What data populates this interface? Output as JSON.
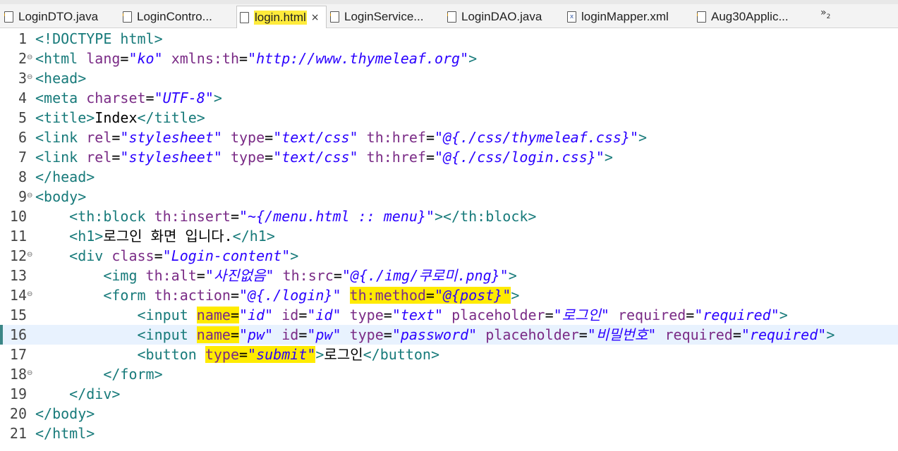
{
  "tabs": [
    {
      "label": "LoginDTO.java",
      "icon": "java-file-icon"
    },
    {
      "label": "LoginContro...",
      "icon": "java-file-icon"
    },
    {
      "label": "login.html",
      "icon": "html-file-icon",
      "active": true
    },
    {
      "label": "LoginService...",
      "icon": "java-file-icon"
    },
    {
      "label": "LoginDAO.java",
      "icon": "java-file-icon"
    },
    {
      "label": "loginMapper.xml",
      "icon": "xml-file-icon"
    },
    {
      "label": "Aug30Applic...",
      "icon": "java-file-icon"
    }
  ],
  "close_glyph": "×",
  "overflow": {
    "glyph": "»",
    "count": "2"
  },
  "colors": {
    "tag": "#177a7a",
    "attribute": "#7a2b86",
    "value": "#2a00ff",
    "highlight": "#ffeb00",
    "current_line": "#e8f2fe"
  },
  "lines": [
    {
      "n": "1",
      "fold": false,
      "parts": [
        {
          "c": "t",
          "s": "<!DOCTYPE html>"
        }
      ]
    },
    {
      "n": "2",
      "fold": true,
      "parts": [
        {
          "c": "t",
          "s": "<html "
        },
        {
          "c": "a",
          "s": "lang"
        },
        {
          "c": "x",
          "s": "="
        },
        {
          "c": "v",
          "s": "\"ko\""
        },
        {
          "c": "x",
          "s": " "
        },
        {
          "c": "a",
          "s": "xmlns:th"
        },
        {
          "c": "x",
          "s": "="
        },
        {
          "c": "v",
          "s": "\"http://www.thymeleaf.org\""
        },
        {
          "c": "t",
          "s": ">"
        }
      ]
    },
    {
      "n": "3",
      "fold": true,
      "parts": [
        {
          "c": "t",
          "s": "<head>"
        }
      ]
    },
    {
      "n": "4",
      "fold": false,
      "parts": [
        {
          "c": "t",
          "s": "<meta "
        },
        {
          "c": "a",
          "s": "charset"
        },
        {
          "c": "x",
          "s": "="
        },
        {
          "c": "v",
          "s": "\"UTF-8\""
        },
        {
          "c": "t",
          "s": ">"
        }
      ]
    },
    {
      "n": "5",
      "fold": false,
      "parts": [
        {
          "c": "t",
          "s": "<title>"
        },
        {
          "c": "x",
          "s": "Index"
        },
        {
          "c": "t",
          "s": "</title>"
        }
      ]
    },
    {
      "n": "6",
      "fold": false,
      "parts": [
        {
          "c": "t",
          "s": "<link "
        },
        {
          "c": "a",
          "s": "rel"
        },
        {
          "c": "x",
          "s": "="
        },
        {
          "c": "v",
          "s": "\"stylesheet\""
        },
        {
          "c": "x",
          "s": " "
        },
        {
          "c": "a",
          "s": "type"
        },
        {
          "c": "x",
          "s": "="
        },
        {
          "c": "v",
          "s": "\"text/css\""
        },
        {
          "c": "x",
          "s": " "
        },
        {
          "c": "a",
          "s": "th:href"
        },
        {
          "c": "x",
          "s": "="
        },
        {
          "c": "v",
          "s": "\"@{./css/thymeleaf.css}\""
        },
        {
          "c": "t",
          "s": ">"
        }
      ]
    },
    {
      "n": "7",
      "fold": false,
      "parts": [
        {
          "c": "t",
          "s": "<link "
        },
        {
          "c": "a",
          "s": "rel"
        },
        {
          "c": "x",
          "s": "="
        },
        {
          "c": "v",
          "s": "\"stylesheet\""
        },
        {
          "c": "x",
          "s": " "
        },
        {
          "c": "a",
          "s": "type"
        },
        {
          "c": "x",
          "s": "="
        },
        {
          "c": "v",
          "s": "\"text/css\""
        },
        {
          "c": "x",
          "s": " "
        },
        {
          "c": "a",
          "s": "th:href"
        },
        {
          "c": "x",
          "s": "="
        },
        {
          "c": "v",
          "s": "\"@{./css/login.css}\""
        },
        {
          "c": "t",
          "s": ">"
        }
      ]
    },
    {
      "n": "8",
      "fold": false,
      "parts": [
        {
          "c": "t",
          "s": "</head>"
        }
      ]
    },
    {
      "n": "9",
      "fold": true,
      "parts": [
        {
          "c": "t",
          "s": "<body>"
        }
      ]
    },
    {
      "n": "10",
      "fold": false,
      "parts": [
        {
          "c": "x",
          "s": "    "
        },
        {
          "c": "t",
          "s": "<th:block "
        },
        {
          "c": "a",
          "s": "th:insert"
        },
        {
          "c": "x",
          "s": "="
        },
        {
          "c": "v",
          "s": "\"~{/menu.html :: menu}\""
        },
        {
          "c": "t",
          "s": "></th:block>"
        }
      ]
    },
    {
      "n": "11",
      "fold": false,
      "parts": [
        {
          "c": "x",
          "s": "    "
        },
        {
          "c": "t",
          "s": "<h1>"
        },
        {
          "c": "x",
          "s": "로그인 화면 입니다."
        },
        {
          "c": "t",
          "s": "</h1>"
        }
      ]
    },
    {
      "n": "12",
      "fold": true,
      "parts": [
        {
          "c": "x",
          "s": "    "
        },
        {
          "c": "t",
          "s": "<div "
        },
        {
          "c": "a",
          "s": "class"
        },
        {
          "c": "x",
          "s": "="
        },
        {
          "c": "v",
          "s": "\"Login-content\""
        },
        {
          "c": "t",
          "s": ">"
        }
      ]
    },
    {
      "n": "13",
      "fold": false,
      "parts": [
        {
          "c": "x",
          "s": "        "
        },
        {
          "c": "t",
          "s": "<img "
        },
        {
          "c": "a",
          "s": "th:alt"
        },
        {
          "c": "x",
          "s": "="
        },
        {
          "c": "v",
          "s": "\"사진없음\""
        },
        {
          "c": "x",
          "s": " "
        },
        {
          "c": "a",
          "s": "th:src"
        },
        {
          "c": "x",
          "s": "="
        },
        {
          "c": "v",
          "s": "\"@{./img/쿠로미.png}\""
        },
        {
          "c": "t",
          "s": ">"
        }
      ]
    },
    {
      "n": "14",
      "fold": true,
      "parts": [
        {
          "c": "x",
          "s": "        "
        },
        {
          "c": "t",
          "s": "<form "
        },
        {
          "c": "a",
          "s": "th:action"
        },
        {
          "c": "x",
          "s": "="
        },
        {
          "c": "v",
          "s": "\"@{./login}\""
        },
        {
          "c": "x",
          "s": " "
        },
        {
          "c": "a",
          "s": "th:method",
          "h": true
        },
        {
          "c": "x",
          "s": "=",
          "h": true
        },
        {
          "c": "v",
          "s": "\"@{post}\"",
          "h": true
        },
        {
          "c": "t",
          "s": ">"
        }
      ]
    },
    {
      "n": "15",
      "fold": false,
      "parts": [
        {
          "c": "x",
          "s": "            "
        },
        {
          "c": "t",
          "s": "<input "
        },
        {
          "c": "a",
          "s": "name",
          "h": true
        },
        {
          "c": "x",
          "s": "=",
          "h": true
        },
        {
          "c": "v",
          "s": "\"id\""
        },
        {
          "c": "x",
          "s": " "
        },
        {
          "c": "a",
          "s": "id"
        },
        {
          "c": "x",
          "s": "="
        },
        {
          "c": "v",
          "s": "\"id\""
        },
        {
          "c": "x",
          "s": " "
        },
        {
          "c": "a",
          "s": "type"
        },
        {
          "c": "x",
          "s": "="
        },
        {
          "c": "v",
          "s": "\"text\""
        },
        {
          "c": "x",
          "s": " "
        },
        {
          "c": "a",
          "s": "placeholder"
        },
        {
          "c": "x",
          "s": "="
        },
        {
          "c": "v",
          "s": "\"로그인\""
        },
        {
          "c": "x",
          "s": " "
        },
        {
          "c": "a",
          "s": "required"
        },
        {
          "c": "x",
          "s": "="
        },
        {
          "c": "v",
          "s": "\"required\""
        },
        {
          "c": "t",
          "s": ">"
        }
      ]
    },
    {
      "n": "16",
      "fold": false,
      "current": true,
      "parts": [
        {
          "c": "x",
          "s": "            "
        },
        {
          "c": "t",
          "s": "<input "
        },
        {
          "c": "a",
          "s": "name",
          "h": true
        },
        {
          "c": "x",
          "s": "=",
          "h": true
        },
        {
          "c": "v",
          "s": "\"pw\""
        },
        {
          "c": "x",
          "s": " "
        },
        {
          "c": "a",
          "s": "id"
        },
        {
          "c": "x",
          "s": "="
        },
        {
          "c": "v",
          "s": "\"pw\""
        },
        {
          "c": "x",
          "s": " "
        },
        {
          "c": "a",
          "s": "type"
        },
        {
          "c": "x",
          "s": "="
        },
        {
          "c": "v",
          "s": "\"password\""
        },
        {
          "c": "x",
          "s": " "
        },
        {
          "c": "a",
          "s": "placeholder"
        },
        {
          "c": "x",
          "s": "="
        },
        {
          "c": "v",
          "s": "\"비밀번호\""
        },
        {
          "c": "x",
          "s": " "
        },
        {
          "c": "a",
          "s": "required"
        },
        {
          "c": "x",
          "s": "="
        },
        {
          "c": "v",
          "s": "\"required\""
        },
        {
          "c": "t",
          "s": ">"
        }
      ]
    },
    {
      "n": "17",
      "fold": false,
      "parts": [
        {
          "c": "x",
          "s": "            "
        },
        {
          "c": "t",
          "s": "<button "
        },
        {
          "c": "a",
          "s": "type",
          "h": true
        },
        {
          "c": "x",
          "s": "=",
          "h": true
        },
        {
          "c": "v",
          "s": "\"submit\"",
          "h": true
        },
        {
          "c": "t",
          "s": ">"
        },
        {
          "c": "x",
          "s": "로그인"
        },
        {
          "c": "t",
          "s": "</button>"
        }
      ]
    },
    {
      "n": "18",
      "fold": true,
      "parts": [
        {
          "c": "x",
          "s": "        "
        },
        {
          "c": "t",
          "s": "</form>"
        }
      ]
    },
    {
      "n": "19",
      "fold": false,
      "parts": [
        {
          "c": "x",
          "s": "    "
        },
        {
          "c": "t",
          "s": "</div>"
        }
      ]
    },
    {
      "n": "20",
      "fold": false,
      "parts": [
        {
          "c": "t",
          "s": "</body>"
        }
      ]
    },
    {
      "n": "21",
      "fold": false,
      "parts": [
        {
          "c": "t",
          "s": "</html>"
        }
      ]
    }
  ]
}
